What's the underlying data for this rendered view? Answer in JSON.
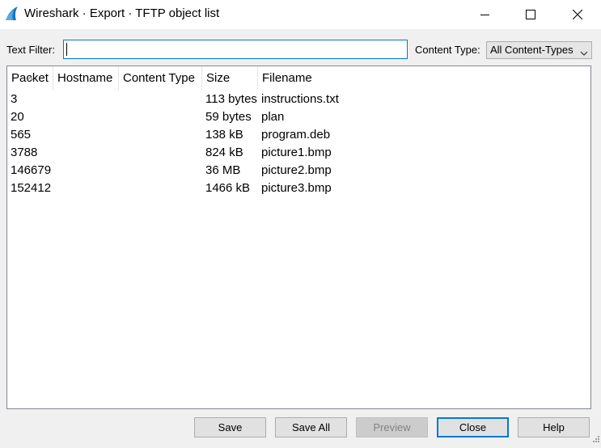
{
  "window": {
    "title": "Wireshark · Export · TFTP object list"
  },
  "filter": {
    "text_filter_label": "Text Filter:",
    "text_filter_value": "",
    "content_type_label": "Content Type:",
    "content_type_value": "All Content-Types"
  },
  "table": {
    "columns": [
      "Packet",
      "Hostname",
      "Content Type",
      "Size",
      "Filename"
    ],
    "rows": [
      {
        "packet": "3",
        "hostname": "",
        "content_type": "",
        "size": "113 bytes",
        "filename": "instructions.txt"
      },
      {
        "packet": "20",
        "hostname": "",
        "content_type": "",
        "size": "59 bytes",
        "filename": "plan"
      },
      {
        "packet": "565",
        "hostname": "",
        "content_type": "",
        "size": "138 kB",
        "filename": "program.deb"
      },
      {
        "packet": "3788",
        "hostname": "",
        "content_type": "",
        "size": "824 kB",
        "filename": "picture1.bmp"
      },
      {
        "packet": "146679",
        "hostname": "",
        "content_type": "",
        "size": "36 MB",
        "filename": "picture2.bmp"
      },
      {
        "packet": "152412",
        "hostname": "",
        "content_type": "",
        "size": "1466 kB",
        "filename": "picture3.bmp"
      }
    ]
  },
  "buttons": {
    "save": "Save",
    "save_all": "Save All",
    "preview": "Preview",
    "close": "Close",
    "help": "Help"
  },
  "colors": {
    "accent": "#0078d7",
    "disabled_text": "#838383"
  }
}
